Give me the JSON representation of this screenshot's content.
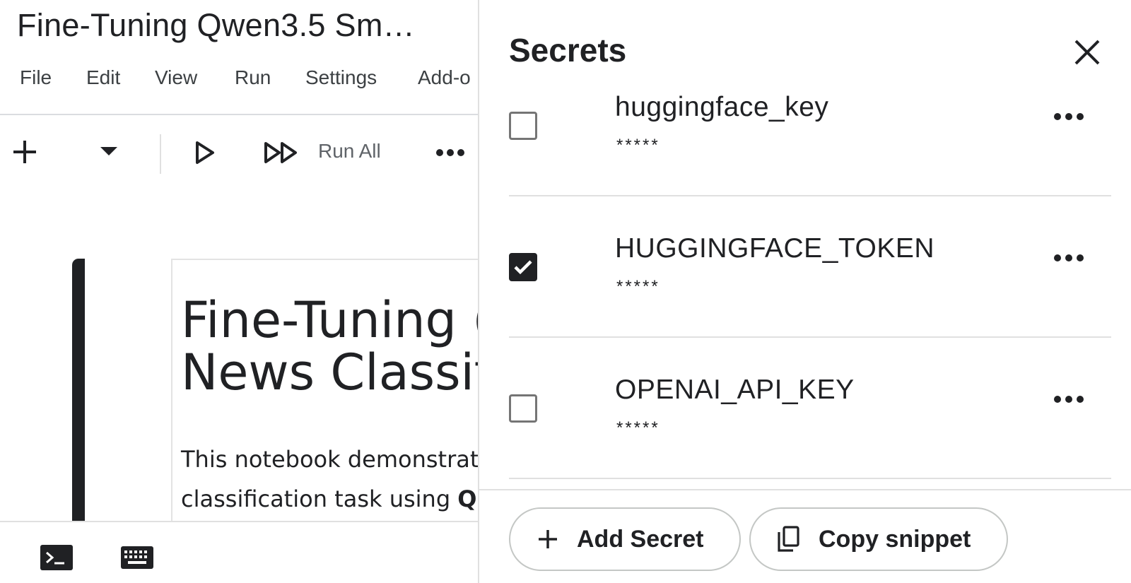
{
  "notebook": {
    "title": "Fine-Tuning Qwen3.5 Sm…",
    "menu": [
      "File",
      "Edit",
      "View",
      "Run",
      "Settings",
      "Add-o"
    ],
    "toolbar": {
      "run_all_label": "Run All"
    },
    "cell": {
      "heading_line1": "Fine-Tuning (",
      "heading_line2": "News Classifi",
      "body_line1": "This notebook demonstrate",
      "body_line2_prefix": "classification task using ",
      "body_line2_bold": "QL"
    },
    "bottom_icons": [
      "terminal-icon",
      "keyboard-icon"
    ]
  },
  "secrets_panel": {
    "title": "Secrets",
    "secrets": [
      {
        "name": "huggingface_key",
        "value": "*****",
        "notebook_access": false
      },
      {
        "name": "HUGGINGFACE_TOKEN",
        "value": "*****",
        "notebook_access": true
      },
      {
        "name": "OPENAI_API_KEY",
        "value": "*****",
        "notebook_access": false
      }
    ],
    "add_secret_label": "Add Secret",
    "copy_snippet_label": "Copy snippet"
  },
  "colors": {
    "text": "#202124",
    "border": "#e0e0e0",
    "checked": "#202124"
  }
}
